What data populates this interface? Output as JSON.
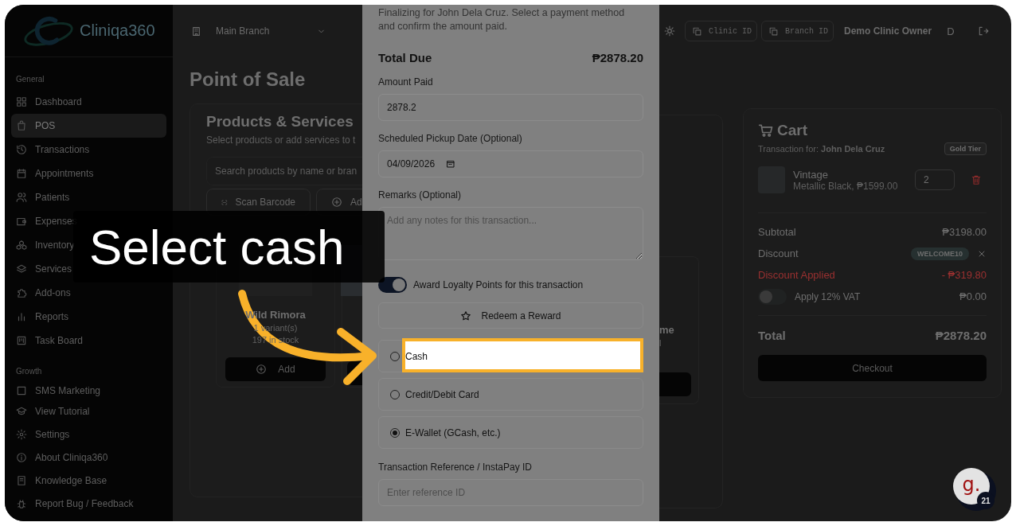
{
  "sidebar": {
    "logo": "Cliniqa360",
    "groups": [
      {
        "title": "General",
        "items": [
          {
            "label": "Dashboard",
            "selected": false
          },
          {
            "label": "POS",
            "selected": true
          },
          {
            "label": "Transactions",
            "selected": false
          },
          {
            "label": "Appointments",
            "selected": false
          },
          {
            "label": "Patients",
            "selected": false
          },
          {
            "label": "Expenses",
            "selected": false
          },
          {
            "label": "Inventory",
            "selected": false
          },
          {
            "label": "Services",
            "selected": false
          },
          {
            "label": "Add-ons",
            "selected": false
          },
          {
            "label": "Reports",
            "selected": false
          },
          {
            "label": "Task Board",
            "selected": false
          }
        ]
      },
      {
        "title": "Growth",
        "items": [
          {
            "label": "SMS Marketing",
            "selected": false
          }
        ]
      }
    ],
    "footer": [
      "View Tutorial",
      "Settings",
      "About Cliniqa360",
      "Knowledge Base",
      "Report Bug / Feedback"
    ]
  },
  "header": {
    "branch": "Main Branch",
    "chips": [
      "Clinic ID",
      "Branch ID"
    ],
    "user": "Demo Clinic Owner",
    "avatar": "D"
  },
  "page_title": "Point of Sale",
  "products": {
    "title": "Products & Services",
    "subtitle": "Select products or add services to t",
    "search_placeholder": "Search products by name or bran",
    "actions": [
      "Scan Barcode",
      "Ad"
    ],
    "card": {
      "name": "Wild Rimora",
      "variants": "1 variant(s)",
      "stock": "197 in stock",
      "button": "Add"
    },
    "right_card": {
      "name": "me",
      "variants": "l"
    }
  },
  "modal": {
    "description": "Finalizing for John Dela Cruz. Select a payment method and confirm the amount paid.",
    "total_label": "Total Due",
    "total_value": "₱2878.20",
    "amount": {
      "label": "Amount Paid",
      "value": "2878.2"
    },
    "pickup": {
      "label": "Scheduled Pickup Date (Optional)",
      "value": "04/09/2026"
    },
    "remarks": {
      "label": "Remarks (Optional)",
      "placeholder": "Add any notes for this transaction..."
    },
    "loyalty": {
      "label": "Award Loyalty Points for this transaction",
      "on": true
    },
    "redeem": "Redeem a Reward",
    "payment_options": [
      {
        "label": "Cash",
        "selected": false,
        "highlighted": true
      },
      {
        "label": "Credit/Debit Card",
        "selected": false,
        "highlighted": false
      },
      {
        "label": "E-Wallet (GCash, etc.)",
        "selected": true,
        "highlighted": false
      }
    ],
    "reference": {
      "label": "Transaction Reference / InstaPay ID",
      "placeholder": "Enter reference ID"
    }
  },
  "cart": {
    "title": "Cart",
    "customer": "Transaction for: **John Dela Cruz**",
    "tier": "Gold Tier",
    "item": {
      "name": "Vintage",
      "detail": "Metallic Black, ₱1599.00",
      "qty": "2"
    },
    "subtotal_label": "Subtotal",
    "subtotal": "₱3198.00",
    "discount_label": "Discount",
    "discount_code": "WELCOME10",
    "applied_label": "Discount Applied",
    "applied": "- ₱319.80",
    "vat": {
      "label": "Apply 12% VAT",
      "on": false,
      "value": "₱0.00"
    },
    "total_label": "Total",
    "total": "₱2878.20",
    "checkout": "Checkout"
  },
  "tutorial": {
    "callout": "Select cash"
  },
  "assistant": {
    "letter": "g.",
    "count": "21"
  }
}
